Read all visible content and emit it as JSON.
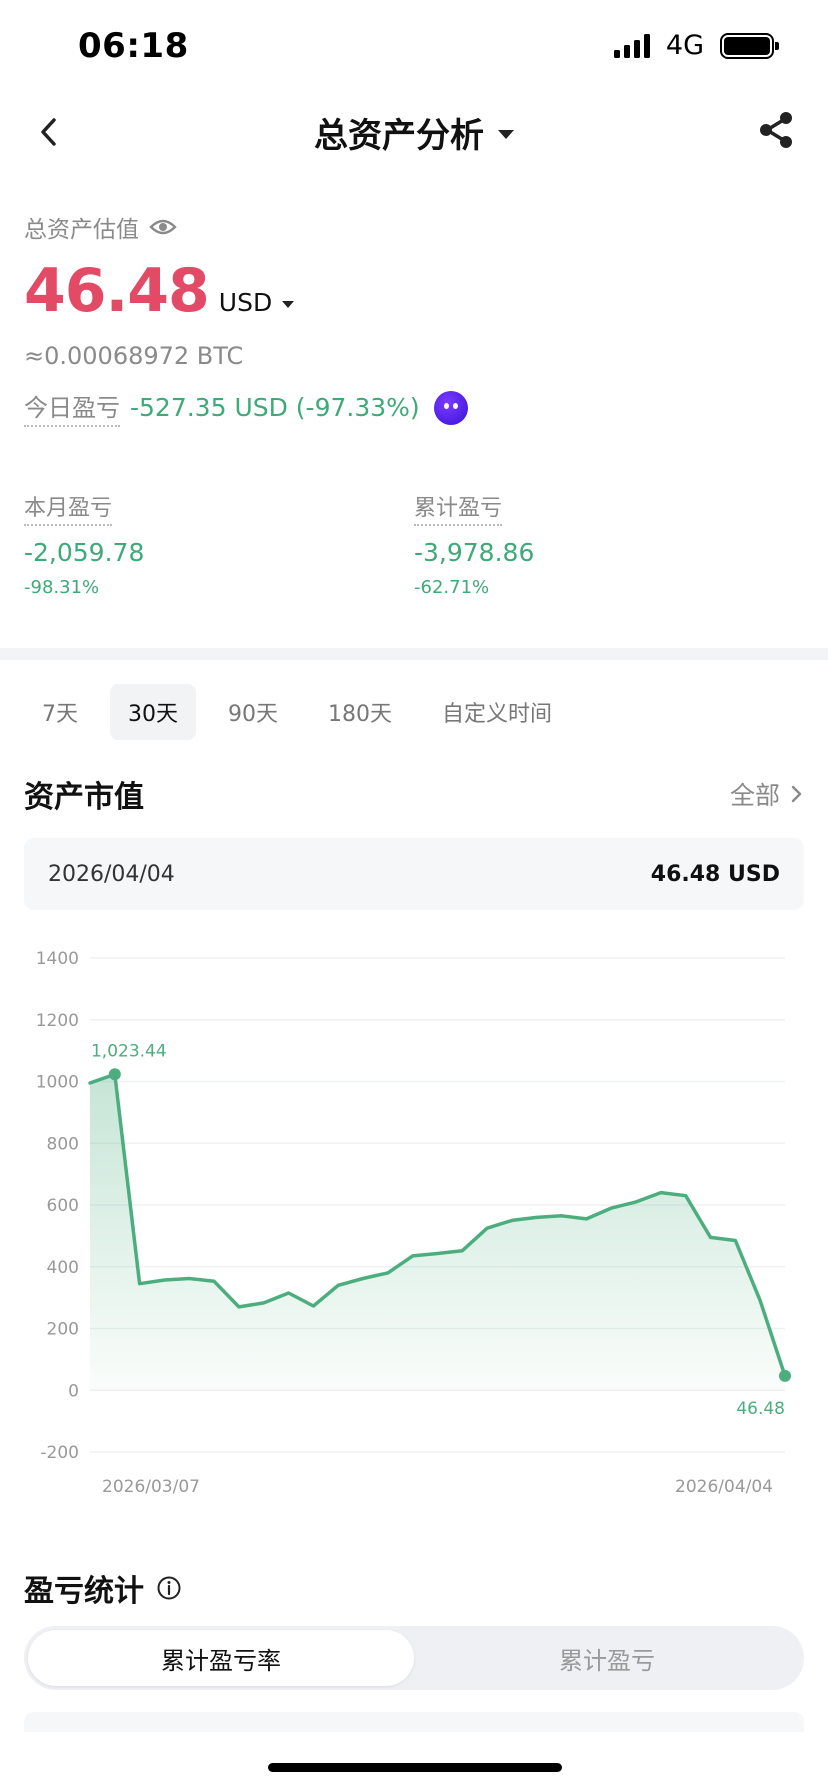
{
  "status_bar": {
    "time": "06:18",
    "network": "4G"
  },
  "nav": {
    "title": "总资产分析"
  },
  "overview": {
    "label": "总资产估值",
    "value": "46.48",
    "currency": "USD",
    "btc_equiv": "≈0.00068972 BTC",
    "today_pnl_label": "今日盈亏",
    "today_pnl_value": "-527.35 USD (-97.33%)"
  },
  "stats": {
    "month_label": "本月盈亏",
    "month_value": "-2,059.78",
    "month_pct": "-98.31%",
    "total_label": "累计盈亏",
    "total_value": "-3,978.86",
    "total_pct": "-62.71%"
  },
  "tabs": [
    "7天",
    "30天",
    "90天",
    "180天",
    "自定义时间"
  ],
  "active_tab": "30天",
  "asset_section": {
    "title": "资产市值",
    "link": "全部",
    "selected_date": "2026/04/04",
    "selected_value": "46.48 USD"
  },
  "chart_data": {
    "type": "area",
    "x_start_label": "2026/03/07",
    "x_end_label": "2026/04/04",
    "yticks": [
      1400,
      1200,
      1000,
      800,
      600,
      400,
      200,
      0,
      -200
    ],
    "ylim": [
      -200,
      1400
    ],
    "values": [
      995,
      1023.44,
      345,
      357,
      362,
      353,
      270,
      283,
      315,
      273,
      340,
      362,
      380,
      435,
      443,
      452,
      525,
      550,
      560,
      565,
      555,
      590,
      610,
      640,
      630,
      495,
      485,
      290,
      46.48
    ],
    "annotations": [
      {
        "index": 1,
        "label": "1,023.44"
      },
      {
        "index": 28,
        "label": "46.48"
      }
    ],
    "line_color": "#4cae7e"
  },
  "pnl_section": {
    "title": "盈亏统计",
    "seg_rate": "累计盈亏率",
    "seg_amount": "累计盈亏"
  }
}
